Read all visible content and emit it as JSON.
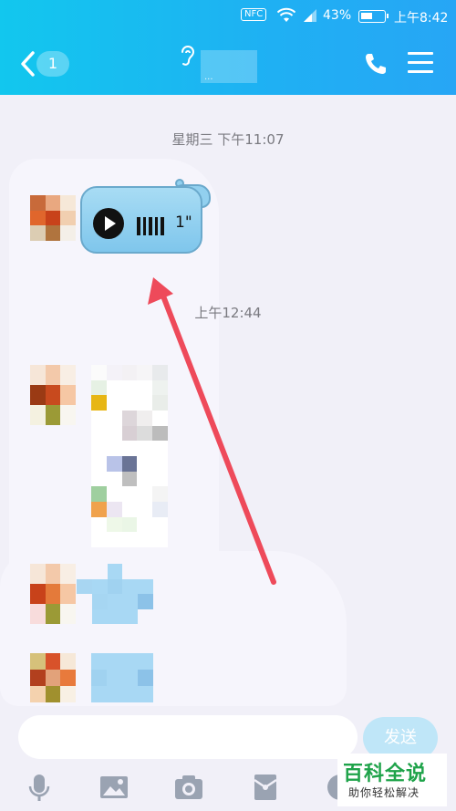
{
  "status_bar": {
    "nfc": "NFC",
    "battery_percent": "43%",
    "time": "上午8:42",
    "battery_level": 0.43
  },
  "header": {
    "unread_count": "1",
    "title_fragment": "..."
  },
  "messages": {
    "timestamp_1": "星期三 下午11:07",
    "voice_duration": "1\"",
    "timestamp_2": "上午12:44"
  },
  "composer": {
    "send_label": "发送",
    "input_value": ""
  },
  "toolbar": {
    "icons": [
      "microphone-icon",
      "image-icon",
      "camera-icon",
      "red-packet-icon",
      "emoji-icon"
    ]
  },
  "watermark": {
    "title": "百科全说",
    "subtitle": "助你轻松解决"
  },
  "colors": {
    "header_start": "#12c7ee",
    "header_end": "#27a6f5",
    "arrow": "#ee4a5a",
    "watermark_green": "#1fa34a"
  }
}
